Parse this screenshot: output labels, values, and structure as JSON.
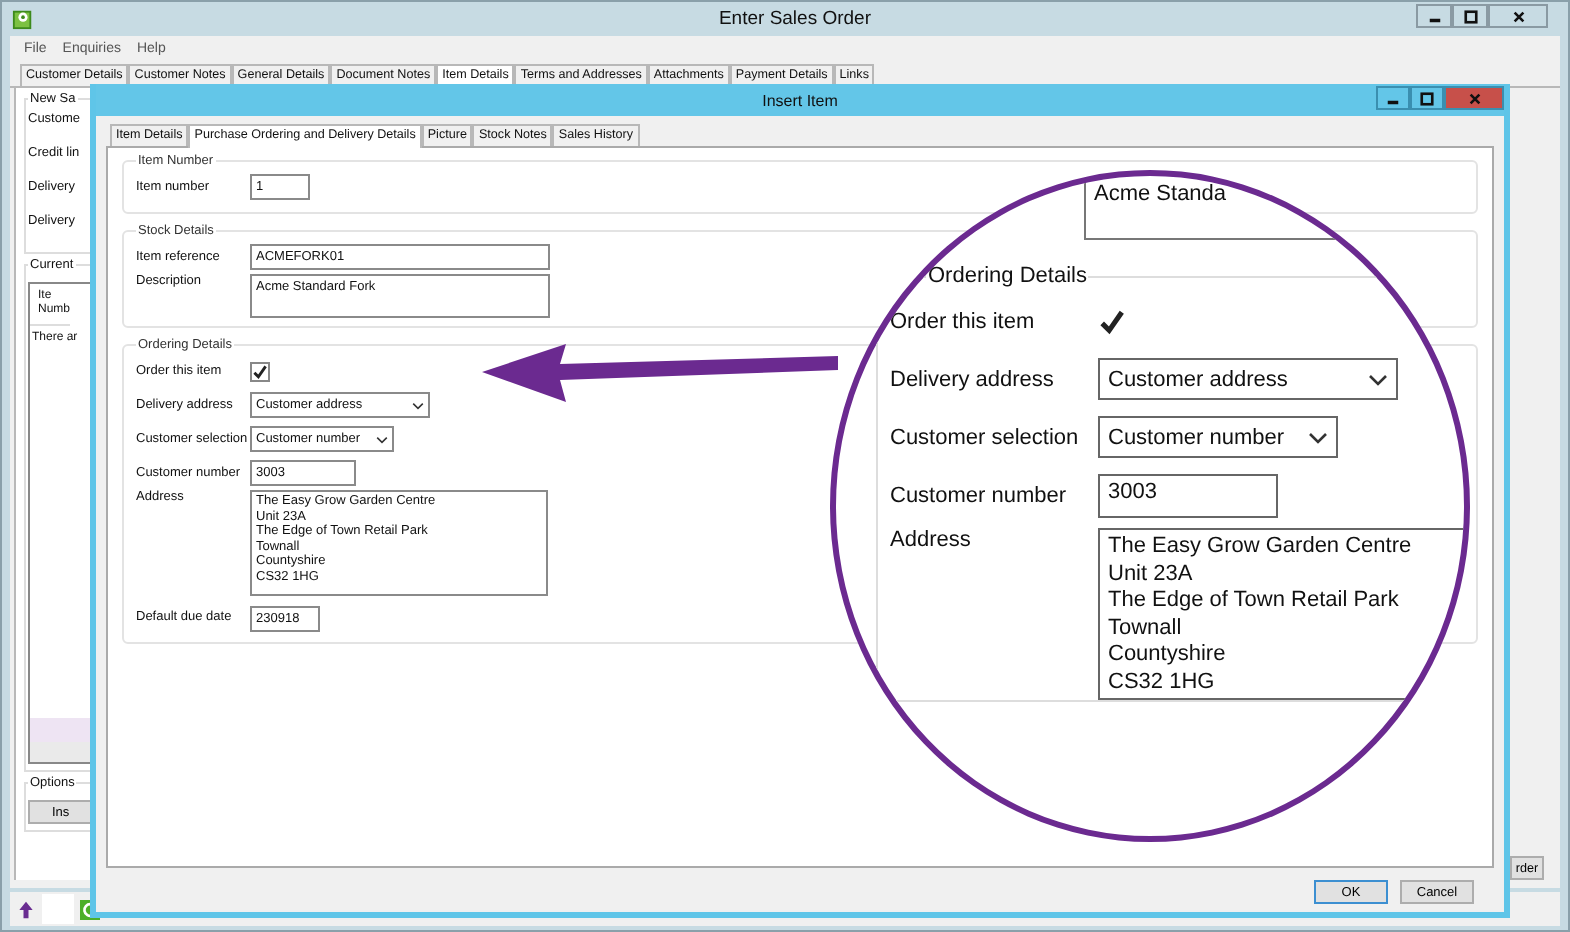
{
  "window": {
    "title": "Enter Sales Order"
  },
  "menu": [
    "File",
    "Enquiries",
    "Help"
  ],
  "tabs": [
    {
      "label": "Customer Details",
      "selected": false
    },
    {
      "label": "Customer Notes",
      "selected": false
    },
    {
      "label": "General Details",
      "selected": false
    },
    {
      "label": "Document Notes",
      "selected": false
    },
    {
      "label": "Item Details",
      "selected": true
    },
    {
      "label": "Terms and Addresses",
      "selected": false
    },
    {
      "label": "Attachments",
      "selected": false
    },
    {
      "label": "Payment Details",
      "selected": false
    },
    {
      "label": "Links",
      "selected": false
    }
  ],
  "background_form": {
    "group_title": "New Sa",
    "labels": [
      "Custome",
      "Credit lin",
      "Delivery",
      "Delivery"
    ],
    "list_group_title": "Current",
    "list_header": "Ite\nNumb",
    "list_message": "There ar",
    "options_group_title": "Options",
    "insert_button": "Ins",
    "order_button": "rder"
  },
  "dialog": {
    "title": "Insert Item",
    "tabs": [
      {
        "label": "Item Details",
        "selected": false
      },
      {
        "label": "Purchase Ordering and Delivery Details",
        "selected": true
      },
      {
        "label": "Picture",
        "selected": false
      },
      {
        "label": "Stock Notes",
        "selected": false
      },
      {
        "label": "Sales History",
        "selected": false
      }
    ],
    "item_number": {
      "title": "Item Number",
      "label": "Item number",
      "value": "1"
    },
    "stock": {
      "title": "Stock Details",
      "reference_label": "Item reference",
      "reference": "ACMEFORK01",
      "description_label": "Description",
      "description": "Acme Standard Fork"
    },
    "ordering": {
      "title": "Ordering Details",
      "order_label": "Order this item",
      "order_checked": true,
      "delivery_label": "Delivery address",
      "delivery_value": "Customer address",
      "selection_label": "Customer selection",
      "selection_value": "Customer number",
      "number_label": "Customer number",
      "number_value": "3003",
      "address_label": "Address",
      "address_lines": [
        "The Easy Grow Garden Centre",
        "Unit 23A",
        "The Edge of Town Retail Park",
        "Townall",
        "Countyshire",
        "CS32 1HG"
      ],
      "due_label": "Default due date",
      "due_value": "230918"
    },
    "buttons": [
      "OK",
      "Cancel"
    ]
  },
  "magnifier": {
    "description_fragment": "Acme Standa",
    "title": "Ordering Details",
    "order_label": "Order this item",
    "order_checked": true,
    "delivery_label": "Delivery address",
    "delivery_value": "Customer address",
    "selection_label": "Customer selection",
    "selection_value": "Customer number",
    "number_label": "Customer number",
    "number_value": "3003",
    "address_label": "Address",
    "address_lines": [
      "The Easy Grow Garden Centre",
      "Unit 23A",
      "The Edge of Town Retail Park",
      "Townall",
      "Countyshire",
      "CS32 1HG"
    ]
  }
}
